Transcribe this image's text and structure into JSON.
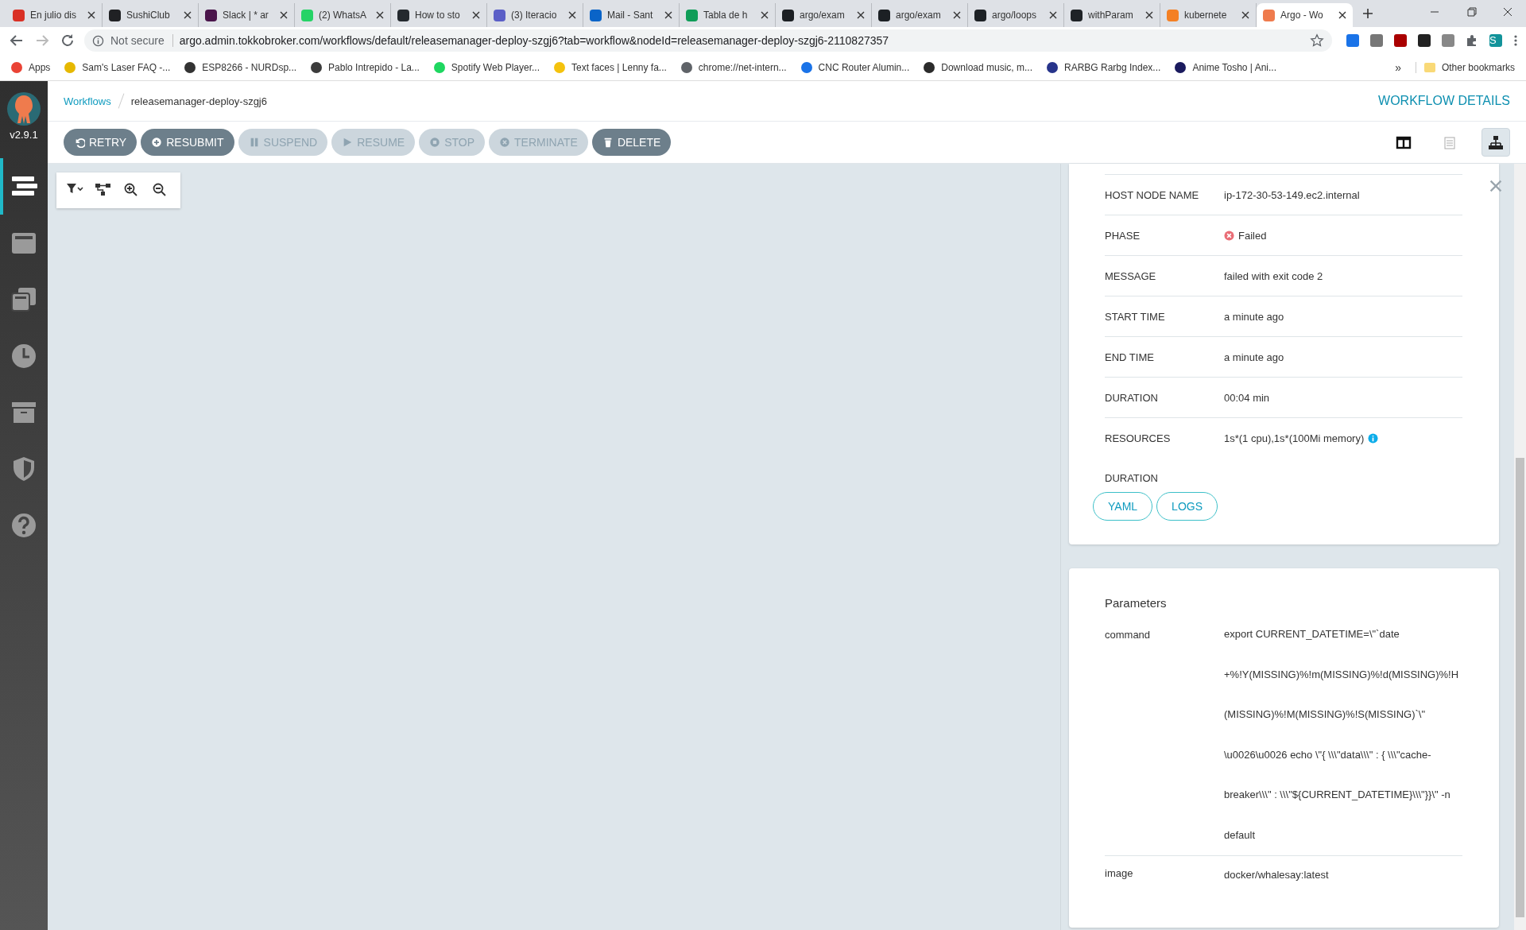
{
  "browser": {
    "tabs": [
      {
        "label": "En julio dis",
        "color": "#d93025",
        "selected": false
      },
      {
        "label": "SushiClub",
        "color": "#202124",
        "selected": false
      },
      {
        "label": "Slack | * ar",
        "color": "#4a154b",
        "selected": false
      },
      {
        "label": "(2) WhatsA",
        "color": "#25d366",
        "selected": false
      },
      {
        "label": "How to sto",
        "color": "#24292e",
        "selected": false
      },
      {
        "label": "(3) Iteracio",
        "color": "#5b5fc7",
        "selected": false
      },
      {
        "label": "Mail - Sant",
        "color": "#0a64c8",
        "selected": false
      },
      {
        "label": "Tabla de h",
        "color": "#0f9d58",
        "selected": false
      },
      {
        "label": "argo/exam",
        "color": "#1b1f23",
        "selected": false
      },
      {
        "label": "argo/exam",
        "color": "#1c2024",
        "selected": false
      },
      {
        "label": "argo/loops",
        "color": "#1d2125",
        "selected": false
      },
      {
        "label": "withParam",
        "color": "#1e2226",
        "selected": false
      },
      {
        "label": "kubernete",
        "color": "#f48024",
        "selected": false
      },
      {
        "label": "Argo - Wo",
        "color": "#ef7b4d",
        "selected": true
      }
    ],
    "security": "Not secure",
    "url": "argo.admin.tokkobroker.com/workflows/default/releasemanager-deploy-szgj6?tab=workflow&nodeId=releasemanager-deploy-szgj6-2110827357",
    "profile": "S",
    "bookmarks": [
      {
        "label": "Apps",
        "color": "#ea4335"
      },
      {
        "label": "Sam's Laser FAQ -...",
        "color": "#e6b800"
      },
      {
        "label": "ESP8266 - NURDsp...",
        "color": "#333333"
      },
      {
        "label": "Pablo Intrepido - La...",
        "color": "#3c3c3c"
      },
      {
        "label": "Spotify Web Player...",
        "color": "#1ed760"
      },
      {
        "label": "Text faces | Lenny fa...",
        "color": "#f4c20d"
      },
      {
        "label": "chrome://net-intern...",
        "color": "#5f6368"
      },
      {
        "label": "CNC Router Alumin...",
        "color": "#1a73e8"
      },
      {
        "label": "Download music, m...",
        "color": "#2b2b2b"
      },
      {
        "label": "RARBG Rarbg Index...",
        "color": "#27348b"
      },
      {
        "label": "Anime Tosho | Ani...",
        "color": "#1a1a5e"
      }
    ],
    "bookmarks_more": "»",
    "other_bookmarks": "Other bookmarks"
  },
  "sidebar": {
    "version": "v2.9.1",
    "items": [
      {
        "kind": "workflows",
        "selected": true
      },
      {
        "kind": "templates",
        "selected": false
      },
      {
        "kind": "cluster-templates",
        "selected": false
      },
      {
        "kind": "cron",
        "selected": false
      },
      {
        "kind": "archive",
        "selected": false
      },
      {
        "kind": "security",
        "selected": false
      },
      {
        "kind": "help",
        "selected": false
      }
    ]
  },
  "breadcrumbs": [
    {
      "label": "Workflows",
      "kind": "link"
    },
    {
      "label": "releasemanager-deploy-szgj6",
      "kind": "current"
    }
  ],
  "page_title": "WORKFLOW DETAILS",
  "actions": [
    {
      "label": "RETRY",
      "kind": "retry",
      "disabled": false
    },
    {
      "label": "RESUBMIT",
      "kind": "resubmit",
      "disabled": false
    },
    {
      "label": "SUSPEND",
      "kind": "suspend",
      "disabled": true
    },
    {
      "label": "RESUME",
      "kind": "resume",
      "disabled": true
    },
    {
      "label": "STOP",
      "kind": "stop",
      "disabled": true
    },
    {
      "label": "TERMINATE",
      "kind": "terminate",
      "disabled": true
    },
    {
      "label": "DELETE",
      "kind": "delete",
      "disabled": false
    }
  ],
  "view_toggles": [
    {
      "kind": "split",
      "selected": false
    },
    {
      "kind": "list",
      "selected": false
    },
    {
      "kind": "graph",
      "selected": true
    }
  ],
  "graph_tools": [
    {
      "kind": "filter"
    },
    {
      "kind": "layout"
    },
    {
      "kind": "zoom-in"
    },
    {
      "kind": "zoom-out"
    }
  ],
  "node_details": {
    "rows": [
      {
        "label": "HOST NODE NAME",
        "value": "ip-172-30-53-149.ec2.internal"
      },
      {
        "label": "PHASE",
        "value": "Failed",
        "failed": true
      },
      {
        "label": "MESSAGE",
        "value": "failed with exit code 2"
      },
      {
        "label": "START TIME",
        "value": "a minute ago"
      },
      {
        "label": "END TIME",
        "value": "a minute ago"
      },
      {
        "label": "DURATION",
        "value": "00:04 min"
      },
      {
        "label": "RESOURCES",
        "value": "1s*(1 cpu),1s*(100Mi memory)",
        "info": true
      },
      {
        "label": "DURATION"
      }
    ],
    "buttons": [
      "YAML",
      "LOGS"
    ]
  },
  "parameters": {
    "title": "Parameters",
    "rows": [
      {
        "name": "command",
        "value": "export CURRENT_DATETIME=\\\"`date +%!Y(MISSING)%!m(MISSING)%!d(MISSING)%!H(MISSING)%!M(MISSING)%!S(MISSING)`\\\" \\u0026\\u0026 echo \\\"{ \\\\\\\"data\\\\\\\" : { \\\\\\\"cache-breaker\\\\\\\" : \\\\\\\"${CURRENT_DATETIME}\\\\\\\"}}\\\" -n default"
      },
      {
        "name": "image",
        "value": "docker/whalesay:latest"
      }
    ]
  }
}
